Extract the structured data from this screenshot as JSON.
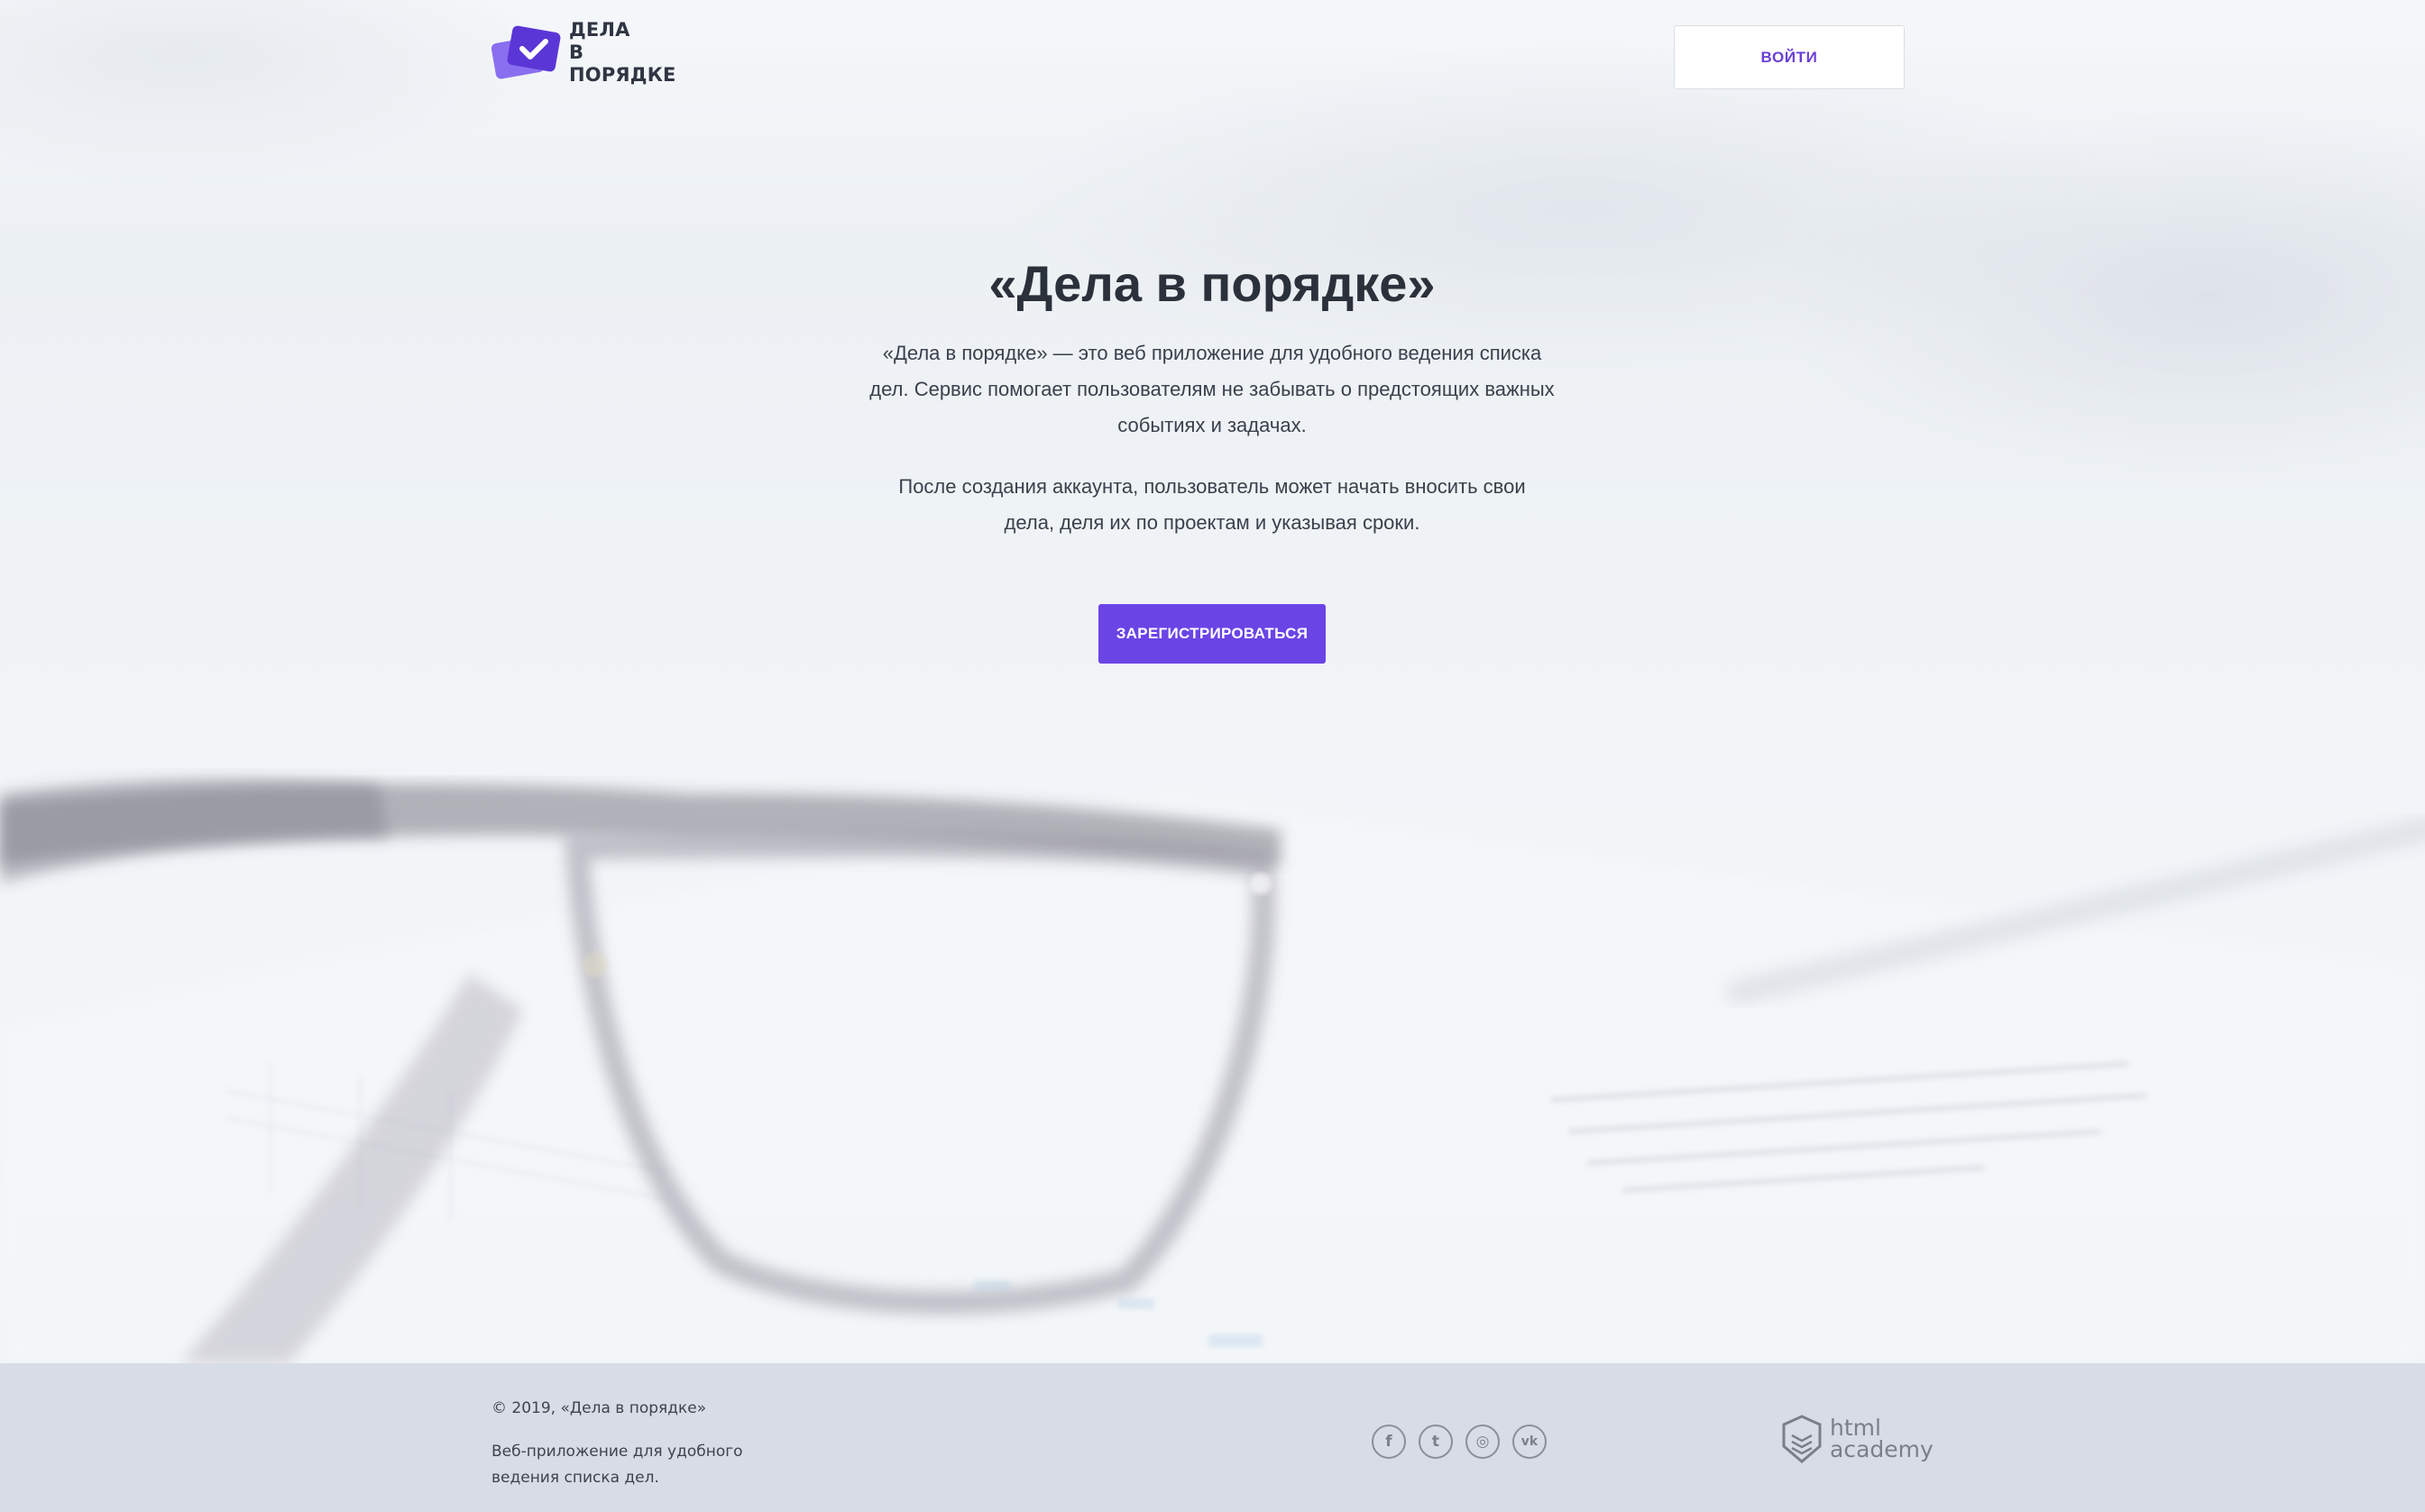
{
  "header": {
    "logo_line1": "ДЕЛА",
    "logo_line2": "В ПОРЯДКЕ",
    "login_label": "ВОЙТИ"
  },
  "hero": {
    "title": "«Дела в порядке»",
    "paragraph1": "«Дела в порядке» — это веб приложение для удобного ведения списка дел. Сервис помогает пользователям не забывать о предстоящих важных событиях и задачах.",
    "paragraph2": "После создания аккаунта, пользователь может начать вносить свои дела, деля их по проектам и указывая сроки.",
    "register_label": "ЗАРЕГИСТРИРОВАТЬСЯ"
  },
  "footer": {
    "copyright": "© 2019, «Дела в порядке»",
    "description": "Веб-приложение для удобного ведения списка дел.",
    "socials": [
      {
        "name": "facebook-icon",
        "glyph": "f"
      },
      {
        "name": "twitter-icon",
        "glyph": "t"
      },
      {
        "name": "instagram-icon",
        "glyph": "◎"
      },
      {
        "name": "vk-icon",
        "glyph": "vk"
      }
    ],
    "academy_line1": "html",
    "academy_line2": "academy"
  },
  "colors": {
    "accent": "#6b44e6",
    "logo_dark": "#5b36d6",
    "logo_light": "#8a6ef0",
    "footer_bg": "#d8dce6",
    "text_dark": "#2b313b"
  }
}
